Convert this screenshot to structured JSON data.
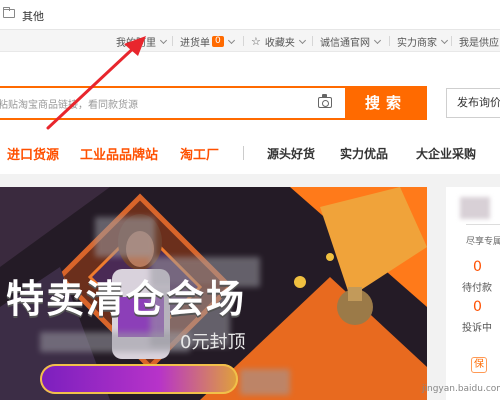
{
  "bookmark_bar": {
    "folder_label": "其他"
  },
  "site_nav": {
    "my_alibaba": "我的阿里",
    "purchase_list": "进货单",
    "purchase_count": "0",
    "favorites": "收藏夹",
    "chengxintong": "诚信通官网",
    "verified_supplier": "实力商家",
    "i_am_supplier": "我是供应"
  },
  "search": {
    "placeholder": "粘贴淘宝商品链接，看同款货源",
    "button": "搜索",
    "publish_button": "发布询价"
  },
  "categories": {
    "primary": [
      "进口货源",
      "工业品品牌站",
      "淘工厂"
    ],
    "secondary": [
      "源头好货",
      "实力优品",
      "大企业采购"
    ]
  },
  "banner": {
    "title": "特卖清仓会场",
    "subtitle": "0元封顶"
  },
  "user_panel": {
    "greeting": "尽享专属",
    "pending_payment_count": "0",
    "pending_payment_label": "待付款",
    "complaints_count": "0",
    "complaints_label": "投诉中",
    "chip": "保"
  },
  "watermark": "jingyan.baidu.com",
  "colors": {
    "accent": "#ff6a00",
    "primary_nav": "#ff5000",
    "annotation_arrow": "#e8262d"
  }
}
